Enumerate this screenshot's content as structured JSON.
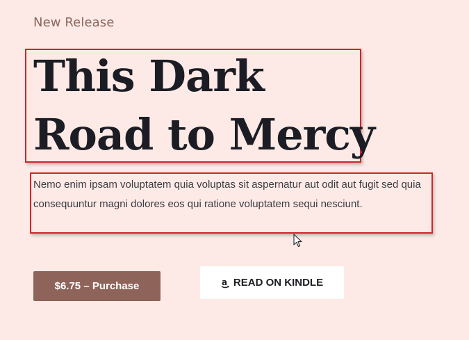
{
  "hero": {
    "eyebrow": "New Release",
    "title_line1": "This Dark",
    "title_line2": "Road to Mercy",
    "description": "Nemo enim ipsam voluptatem quia voluptas sit aspernatur aut odit aut fugit sed quia consequuntur magni dolores eos qui ratione voluptatem sequi nesciunt."
  },
  "actions": {
    "purchase_label": "$6.75 – Purchase",
    "kindle_label": "READ ON KINDLE",
    "kindle_icon": "amazon-icon"
  },
  "colors": {
    "background": "#fdeae6",
    "accent": "#8e635a",
    "highlight_border": "#d4232b",
    "title_text": "#1c1d24"
  }
}
